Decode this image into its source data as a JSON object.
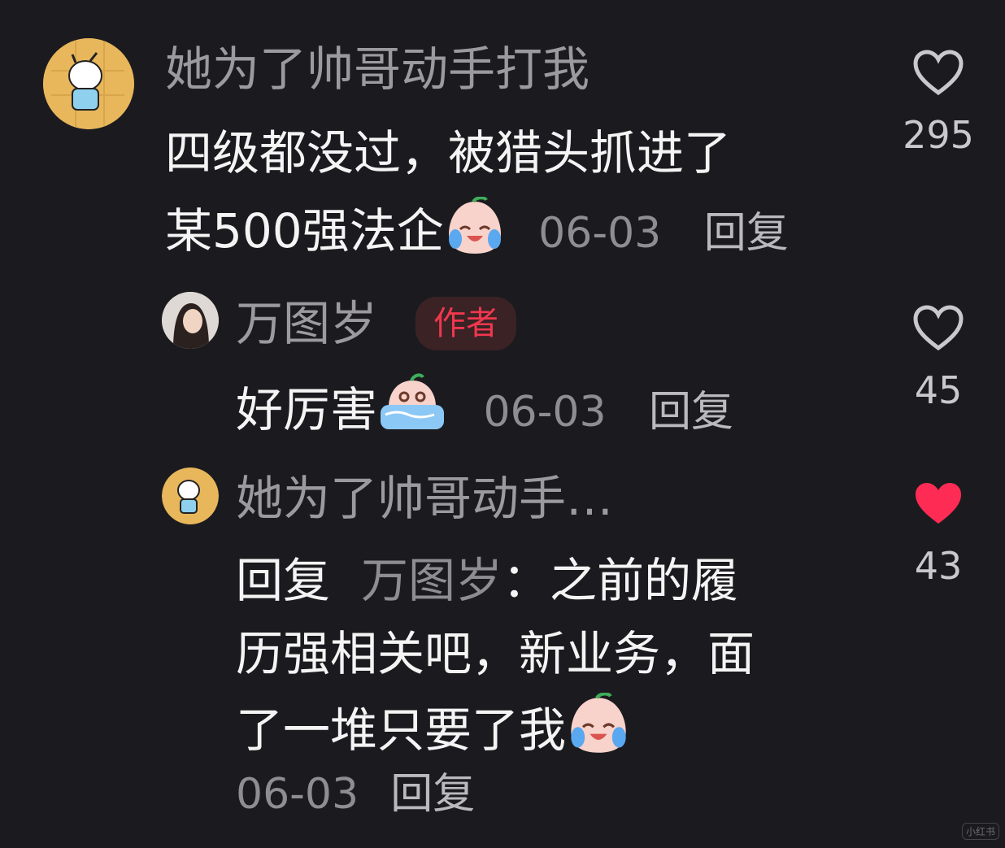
{
  "comments": [
    {
      "username": "她为了帅哥动手打我",
      "text_line1": "四级都没过，被猎头抓进了",
      "text_line2": "某500强法企",
      "emoji": "crying-laughing-emoji",
      "date": "06-03",
      "reply_label": "回复",
      "likes": "295",
      "liked": false
    },
    {
      "username": "万图岁",
      "badge": "作者",
      "text": "好厉害",
      "emoji": "sobbing-emoji",
      "date": "06-03",
      "reply_label": "回复",
      "likes": "45",
      "liked": false
    },
    {
      "username": "她为了帅哥动手…",
      "reply_prefix": "回复",
      "reply_to": "万图岁",
      "colon": "：",
      "text_line1_rest": "之前的履",
      "text_line2": "历强相关吧，新业务，面",
      "text_line3": "了一堆只要了我",
      "emoji": "crying-laughing-emoji",
      "date": "06-03",
      "reply_label": "回复",
      "likes": "43",
      "liked": true
    }
  ],
  "colors": {
    "background": "#1b1b1f",
    "badge_text": "#f0384e",
    "liked_heart": "#fe2c55"
  },
  "watermark": "小红书"
}
